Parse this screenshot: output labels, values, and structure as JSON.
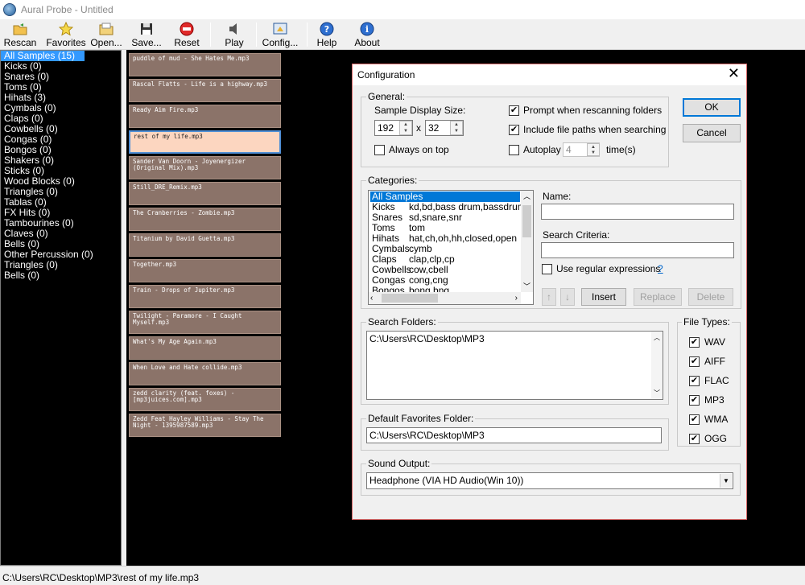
{
  "window": {
    "title": "Aural Probe - Untitled"
  },
  "toolbar": {
    "rescan": "Rescan",
    "favorites": "Favorites",
    "open": "Open...",
    "save": "Save...",
    "reset": "Reset",
    "play": "Play",
    "config": "Config...",
    "help": "Help",
    "about": "About"
  },
  "categories_list": [
    "All Samples (15)",
    "Kicks (0)",
    "Snares (0)",
    "Toms (0)",
    "Hihats (3)",
    "Cymbals (0)",
    "Claps (0)",
    "Cowbells (0)",
    "Congas (0)",
    "Bongos (0)",
    "Shakers (0)",
    "Sticks (0)",
    "Wood Blocks (0)",
    "Triangles (0)",
    "Tablas (0)",
    "FX Hits (0)",
    "Tambourines (0)",
    "Claves (0)",
    "Bells (0)",
    "Other Percussion (0)",
    "Triangles (0)",
    "Bells (0)"
  ],
  "samples": [
    "puddle of mud - She Hates Me.mp3",
    "Rascal Flatts - Life is a highway.mp3",
    "Ready Aim Fire.mp3",
    "rest of my life.mp3",
    "Sander Van Doorn - Joyenergizer (Original Mix).mp3",
    "Still_DRE_Remix.mp3",
    "The Cranberries - Zombie.mp3",
    "Titanium by David Guetta.mp3",
    "Together.mp3",
    "Train - Drops of Jupiter.mp3",
    "Twilight - Paramore - I Caught Myself.mp3",
    "What's My Age Again.mp3",
    "When Love and Hate collide.mp3",
    "zedd clarity (feat. foxes) - [mp3juices.com].mp3",
    "Zedd Feat Hayley Williams - Stay The Night - 1395987589.mp3"
  ],
  "status": "C:\\Users\\RC\\Desktop\\MP3\\rest of my life.mp3",
  "dialog": {
    "title": "Configuration",
    "close": "✕",
    "general": {
      "label": "General:",
      "display_size_label": "Sample Display Size:",
      "width": "192",
      "x": "x",
      "height": "32",
      "always_on_top": "Always on top",
      "prompt_rescan": "Prompt when rescanning folders",
      "include_paths": "Include file paths when searching",
      "autoplay": "Autoplay",
      "autoplay_times": "4",
      "times_label": "time(s)"
    },
    "ok": "OK",
    "cancel": "Cancel",
    "categories": {
      "label": "Categories:",
      "rows": [
        {
          "name": "All Samples",
          "criteria": ""
        },
        {
          "name": "Kicks",
          "criteria": "kd,bd,bass drum,bassdrum,ba"
        },
        {
          "name": "Snares",
          "criteria": "sd,snare,snr"
        },
        {
          "name": "Toms",
          "criteria": "tom"
        },
        {
          "name": "Hihats",
          "criteria": "hat,ch,oh,hh,closed,open"
        },
        {
          "name": "Cymbals",
          "criteria": "cymb"
        },
        {
          "name": "Claps",
          "criteria": "clap,clp,cp"
        },
        {
          "name": "Cowbells",
          "criteria": "cow,cbell"
        },
        {
          "name": "Congas",
          "criteria": "cong,cng"
        },
        {
          "name": "Bongos",
          "criteria": "bong,bng"
        }
      ],
      "name_label": "Name:",
      "name_value": "",
      "search_label": "Search Criteria:",
      "search_value": "",
      "regex_label": "Use regular expressions",
      "regex_help": "?",
      "insert": "Insert",
      "replace": "Replace",
      "delete": "Delete"
    },
    "search_folders": {
      "label": "Search Folders:",
      "value": "C:\\Users\\RC\\Desktop\\MP3"
    },
    "file_types": {
      "label": "File Types:",
      "items": [
        "WAV",
        "AIFF",
        "FLAC",
        "MP3",
        "WMA",
        "OGG"
      ]
    },
    "favorites_folder": {
      "label": "Default Favorites Folder:",
      "value": "C:\\Users\\RC\\Desktop\\MP3"
    },
    "sound_output": {
      "label": "Sound Output:",
      "value": "Headphone (VIA HD Audio(Win 10))"
    }
  }
}
